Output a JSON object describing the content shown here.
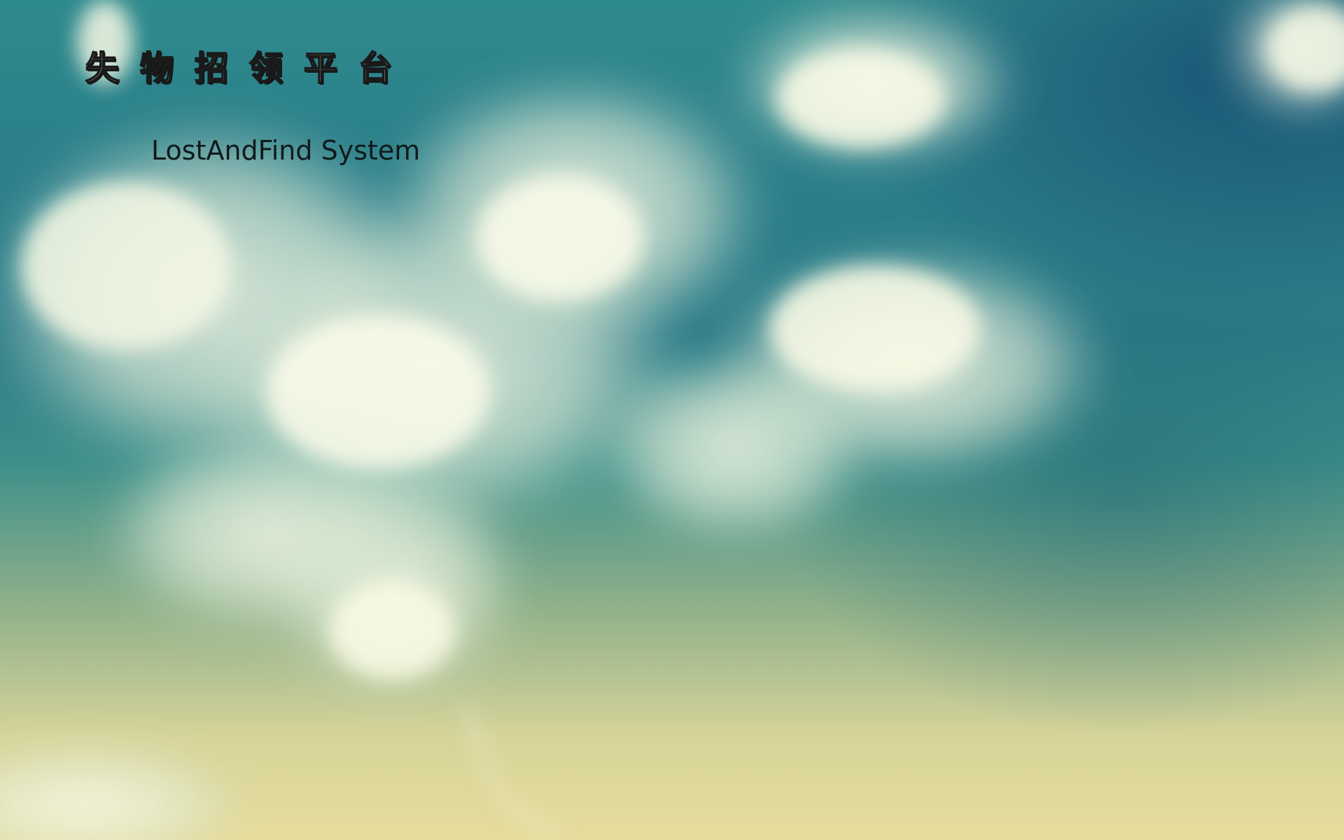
{
  "header": {
    "title_cn": "失物招领平台",
    "title_en": "LostAndFind System"
  },
  "background": {
    "description_colors": {
      "sky_top": "#2b7f8a",
      "sky_deep": "#12466e",
      "horizon": "#e6dc9c",
      "cloud": "#f4f6e6"
    }
  }
}
